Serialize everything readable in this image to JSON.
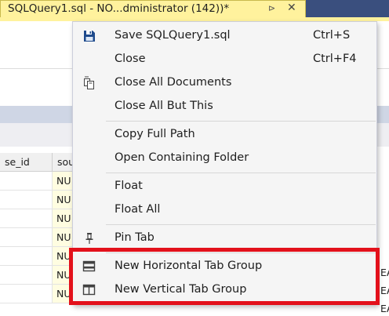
{
  "editor": {
    "tab_title": "SQLQuery1.sql - NO...dministrator (142))*",
    "tab_pin_glyph": "⊳",
    "tab_close_glyph": "✕"
  },
  "results_grid": {
    "columns": [
      "se_id",
      "sou"
    ],
    "rows": [
      [
        "",
        "NU"
      ],
      [
        "",
        "NU"
      ],
      [
        "",
        "NU"
      ],
      [
        "",
        "NU"
      ],
      [
        "",
        "NU"
      ],
      [
        "",
        "NU"
      ],
      [
        "",
        "NUU"
      ]
    ],
    "right_column_fragments": [
      "EA",
      "EA",
      "EA"
    ]
  },
  "context_menu": {
    "items": [
      {
        "label": "Save SQLQuery1.sql",
        "shortcut": "Ctrl+S",
        "icon": "save-icon"
      },
      {
        "label": "Close",
        "shortcut": "Ctrl+F4",
        "icon": ""
      },
      {
        "label": "Close All Documents",
        "shortcut": "",
        "icon": "close-all-documents-icon"
      },
      {
        "label": "Close All But This",
        "shortcut": "",
        "icon": ""
      },
      {
        "label": "Copy Full Path",
        "shortcut": "",
        "icon": ""
      },
      {
        "label": "Open Containing Folder",
        "shortcut": "",
        "icon": ""
      },
      {
        "label": "Float",
        "shortcut": "",
        "icon": ""
      },
      {
        "label": "Float All",
        "shortcut": "",
        "icon": ""
      },
      {
        "label": "Pin Tab",
        "shortcut": "",
        "icon": "pin-icon"
      },
      {
        "label": "New Horizontal Tab Group",
        "shortcut": "",
        "icon": "horizontal-tab-group-icon"
      },
      {
        "label": "New Vertical Tab Group",
        "shortcut": "",
        "icon": "vertical-tab-group-icon"
      }
    ]
  },
  "colors": {
    "active_tab": "#fff29d",
    "tab_strip": "#3a4f7e",
    "menu_background": "#f5f5f5",
    "highlight": "#e3111b",
    "null_cell": "#fffde1"
  }
}
